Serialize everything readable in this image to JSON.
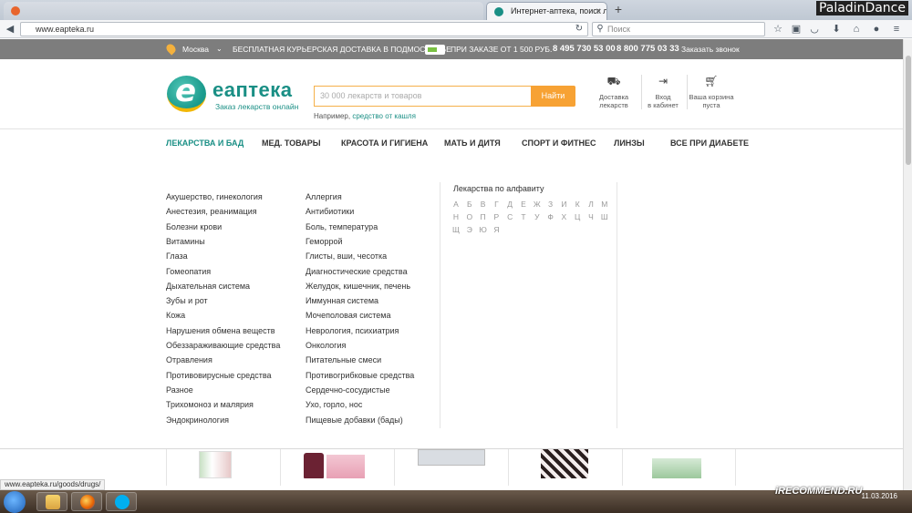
{
  "browser": {
    "tabs": [
      {
        "title": "",
        "active": false
      },
      {
        "title": "Интернет-аптека, поиск л...",
        "active": true
      }
    ],
    "new_tab": "+",
    "user": "PaladinDance",
    "url": "www.eapteka.ru",
    "search_placeholder": "Поиск",
    "status_url": "www.eapteka.ru/goods/drugs/"
  },
  "topbar": {
    "city": "Москва",
    "city_arrow": "⌄",
    "delivery": "БЕСПЛАТНАЯ КУРЬЕРСКАЯ ДОСТАВКА В ПОДМОСКОВЬЕ",
    "order_min": "ПРИ ЗАКАЗЕ ОТ 1 500 РУБ.",
    "phone1": "8 495 730 53 00",
    "phone2": "8 800 775 03 33",
    "callback": "Заказать звонок"
  },
  "header": {
    "logo_letter": "e",
    "logo_text": "еаптека",
    "logo_sub": "Заказ лекарств онлайн",
    "search_placeholder": "30 000 лекарств и товаров",
    "search_button": "Найти",
    "example_prefix": "Например,",
    "example_link": "средство от кашля",
    "actions": [
      {
        "icon": "truck-icon",
        "line1": "Доставка",
        "line2": "лекарств"
      },
      {
        "icon": "login-icon",
        "line1": "Вход",
        "line2": "в кабинет"
      },
      {
        "icon": "basket-icon",
        "line1": "Ваша корзина",
        "line2": "пуста"
      }
    ]
  },
  "menu": [
    "ЛЕКАРСТВА И БАД",
    "МЕД. ТОВАРЫ",
    "КРАСОТА И ГИГИЕНА",
    "МАТЬ И ДИТЯ",
    "СПОРТ И ФИТНЕС",
    "ЛИНЗЫ",
    "ВСЕ ПРИ ДИАБЕТЕ"
  ],
  "dropdown": {
    "col1": [
      "Акушерство, гинекология",
      "Анестезия, реанимация",
      "Болезни крови",
      "Витамины",
      "Глаза",
      "Гомеопатия",
      "Дыхательная система",
      "Зубы и рот",
      "Кожа",
      "Нарушения обмена веществ",
      "Обеззараживающие средства",
      "Отравления",
      "Противовирусные средства",
      "Разное",
      "Трихомоноз и малярия",
      "Эндокринология"
    ],
    "col2": [
      "Аллергия",
      "Антибиотики",
      "Боль, температура",
      "Геморрой",
      "Глисты, вши, чесотка",
      "Диагностические средства",
      "Желудок, кишечник, печень",
      "Иммунная система",
      "Мочеполовая система",
      "Неврология, психиатрия",
      "Онкология",
      "Питательные смеси",
      "Противогрибковые средства",
      "Сердечно-сосудистые",
      "Ухо, горло, нос",
      "Пищевые добавки (бады)"
    ],
    "alphabet_title": "Лекарства по алфавиту",
    "letters": [
      "А",
      "Б",
      "В",
      "Г",
      "Д",
      "Е",
      "Ж",
      "З",
      "И",
      "К",
      "Л",
      "М",
      "Н",
      "О",
      "П",
      "Р",
      "С",
      "Т",
      "У",
      "Ф",
      "Х",
      "Ц",
      "Ч",
      "Ш",
      "Щ",
      "Э",
      "Ю",
      "Я"
    ]
  },
  "taskbar": {
    "time": "11.03.2016",
    "watermark": "iRECOMMEND.RU"
  },
  "colors": {
    "brand": "#1a8f85",
    "accent": "#f7a234",
    "topbar": "#7d7d7d"
  }
}
